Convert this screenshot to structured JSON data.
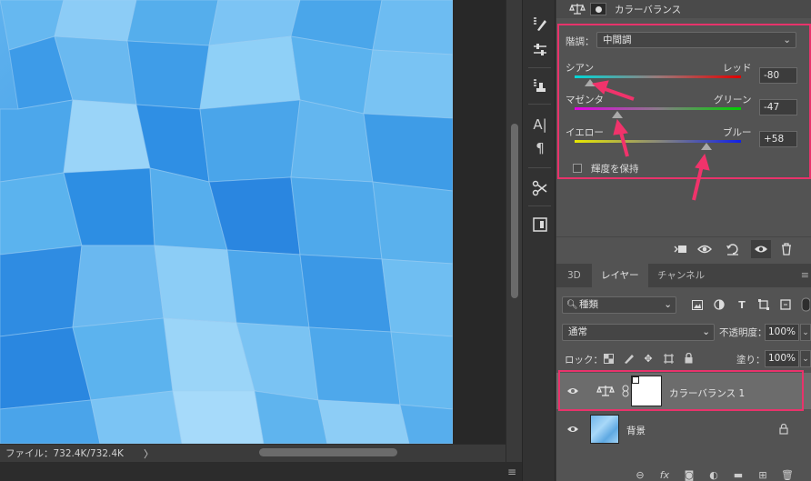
{
  "statusbar": {
    "file_info": "ファイル：732.4K/732.4K",
    "arrow": "〉"
  },
  "properties": {
    "title": "カラーバランス",
    "tone_label": "階調：",
    "tone_value": "中間調",
    "sliders": [
      {
        "left": "シアン",
        "right": "レッド",
        "value": "-80",
        "level": -80
      },
      {
        "left": "マゼンタ",
        "right": "グリーン",
        "value": "-47",
        "level": -47
      },
      {
        "left": "イエロー",
        "right": "ブルー",
        "value": "+58",
        "level": 58
      }
    ],
    "preserve_luminosity": "輝度を保持"
  },
  "layers_panel": {
    "tabs": [
      "3D",
      "レイヤー",
      "チャンネル"
    ],
    "filter_value": "種類",
    "blend_mode": "通常",
    "opacity_label": "不透明度：",
    "opacity_value": "100%",
    "lock_label": "ロック：",
    "fill_label": "塗り：",
    "fill_value": "100%",
    "layers": [
      {
        "name": "カラーバランス 1",
        "selected": true
      },
      {
        "name": "背景",
        "selected": false
      }
    ]
  },
  "colors": {
    "highlight": "#e8336b",
    "panel": "#535353",
    "canvas_blue": "#3a9ae8"
  }
}
